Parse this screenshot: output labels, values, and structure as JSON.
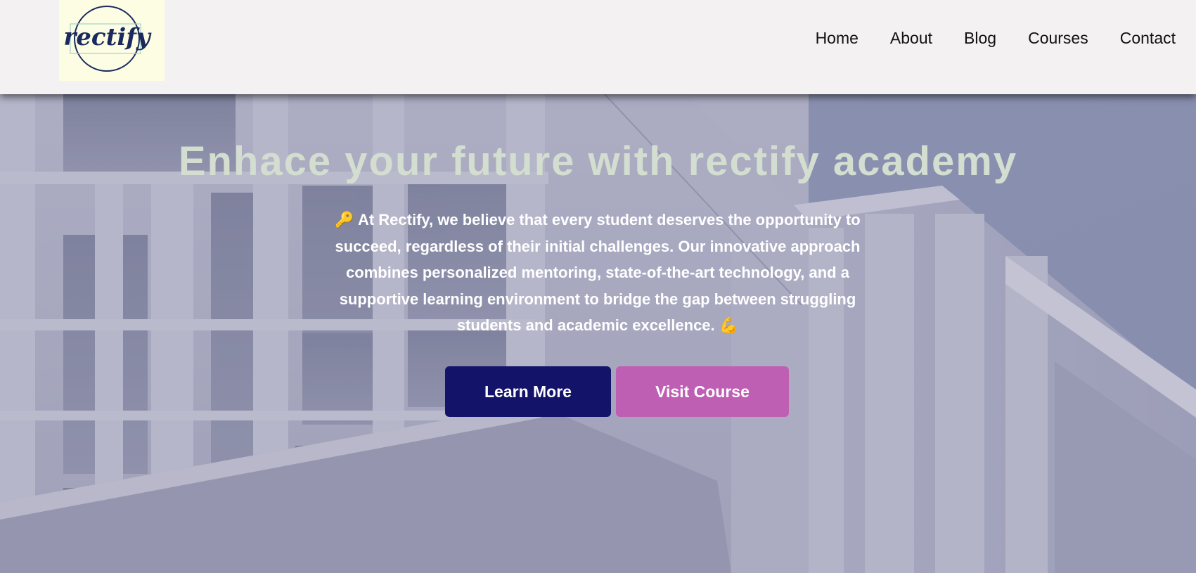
{
  "header": {
    "logo_text": "rectify",
    "nav": [
      {
        "label": "Home"
      },
      {
        "label": "About"
      },
      {
        "label": "Blog"
      },
      {
        "label": "Courses"
      },
      {
        "label": "Contact"
      }
    ]
  },
  "hero": {
    "title": "Enhace your future with rectify academy",
    "icon_key": "🔑",
    "description": "At Rectify, we believe that every student deserves the opportunity to succeed, regardless of their initial challenges. Our innovative approach combines personalized mentoring, state-of-the-art technology, and a supportive learning environment to bridge the gap between struggling students and academic excellence.",
    "icon_muscle": "💪",
    "buttons": {
      "learn_more": "Learn More",
      "visit_course": "Visit Course"
    }
  },
  "colors": {
    "header_bg": "#f3f1f2",
    "logo_bg": "#fdfde4",
    "logo_ink": "#1b2a5e",
    "title": "#d3ddd0",
    "learn_more_bg": "#14136a",
    "visit_course_bg": "#bf5fb4"
  }
}
